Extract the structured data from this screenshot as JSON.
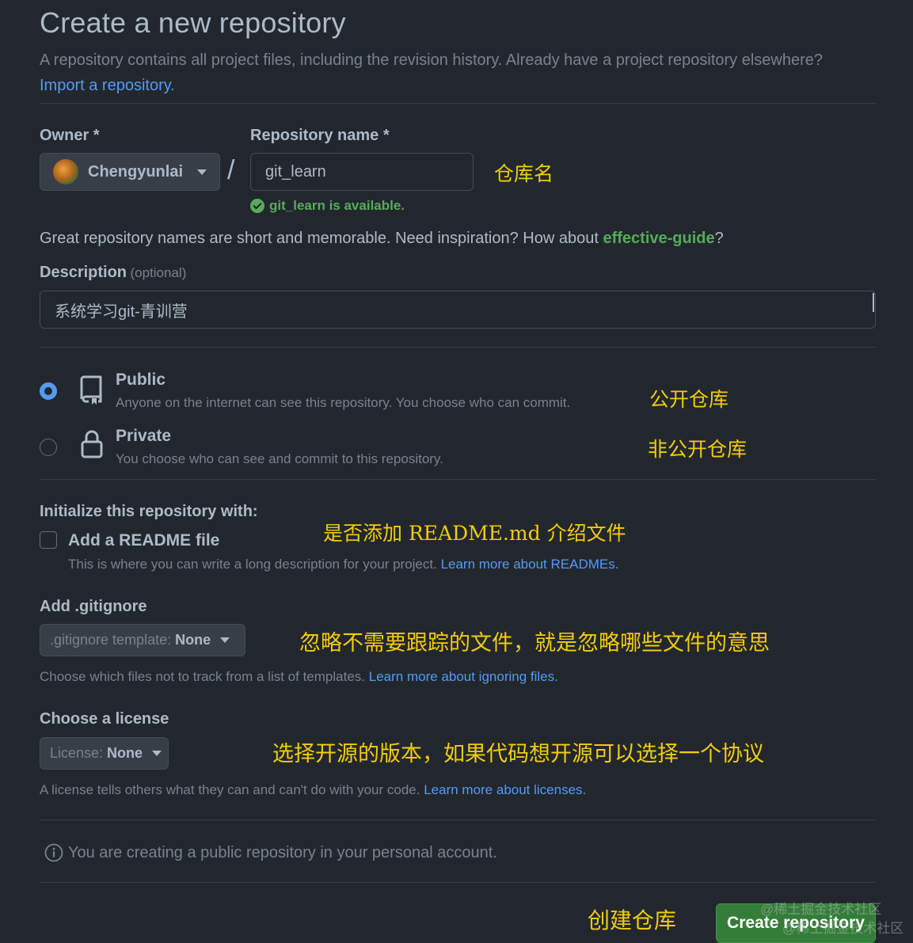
{
  "header": {
    "title": "Create a new repository",
    "subtitle": "A repository contains all project files, including the revision history. Already have a project repository elsewhere?",
    "import_link": "Import a repository."
  },
  "owner": {
    "label": "Owner *",
    "value": "Chengyunlai",
    "icon": "avatar"
  },
  "slash": "/",
  "repo_name": {
    "label": "Repository name *",
    "value": "git_learn",
    "availability": "git_learn is available."
  },
  "suggestion": {
    "prefix": "Great repository names are short and memorable. Need inspiration? How about ",
    "name": "effective-guide",
    "suffix": "?"
  },
  "description": {
    "label": "Description",
    "optional": "(optional)",
    "value": "系统学习git-青训营"
  },
  "visibility": {
    "public": {
      "label": "Public",
      "desc": "Anyone on the internet can see this repository. You choose who can commit.",
      "selected": true
    },
    "private": {
      "label": "Private",
      "desc": "You choose who can see and commit to this repository.",
      "selected": false
    }
  },
  "initialize": {
    "heading": "Initialize this repository with:",
    "readme_label": "Add a README file",
    "readme_desc": "This is where you can write a long description for your project.",
    "readme_link": "Learn more about READMEs."
  },
  "gitignore": {
    "heading": "Add .gitignore",
    "select_prefix": ".gitignore template:",
    "select_value": "None",
    "desc": "Choose which files not to track from a list of templates.",
    "link": "Learn more about ignoring files."
  },
  "license": {
    "heading": "Choose a license",
    "select_prefix": "License:",
    "select_value": "None",
    "desc": "A license tells others what they can and can't do with your code.",
    "link": "Learn more about licenses."
  },
  "notice": {
    "text": "You are creating a public repository in your personal account."
  },
  "submit": {
    "label": "Create repository"
  },
  "annotations": {
    "repo_name": "仓库名",
    "public": "公开仓库",
    "private": "非公开仓库",
    "readme": "是否添加 README.md 介绍文件",
    "gitignore": "忽略不需要跟踪的文件，就是忽略哪些文件的意思",
    "license": "选择开源的版本，如果代码想开源可以选择一个协议",
    "create": "创建仓库"
  },
  "watermark": {
    "line1": "@稀土掘金技术社区",
    "line2": "@稀土掘金技术社区"
  },
  "colors": {
    "background": "#22272e",
    "accent": "#539bf5",
    "success": "#57ab5a",
    "annotation": "#f2cc0c",
    "button": "#347d39"
  }
}
